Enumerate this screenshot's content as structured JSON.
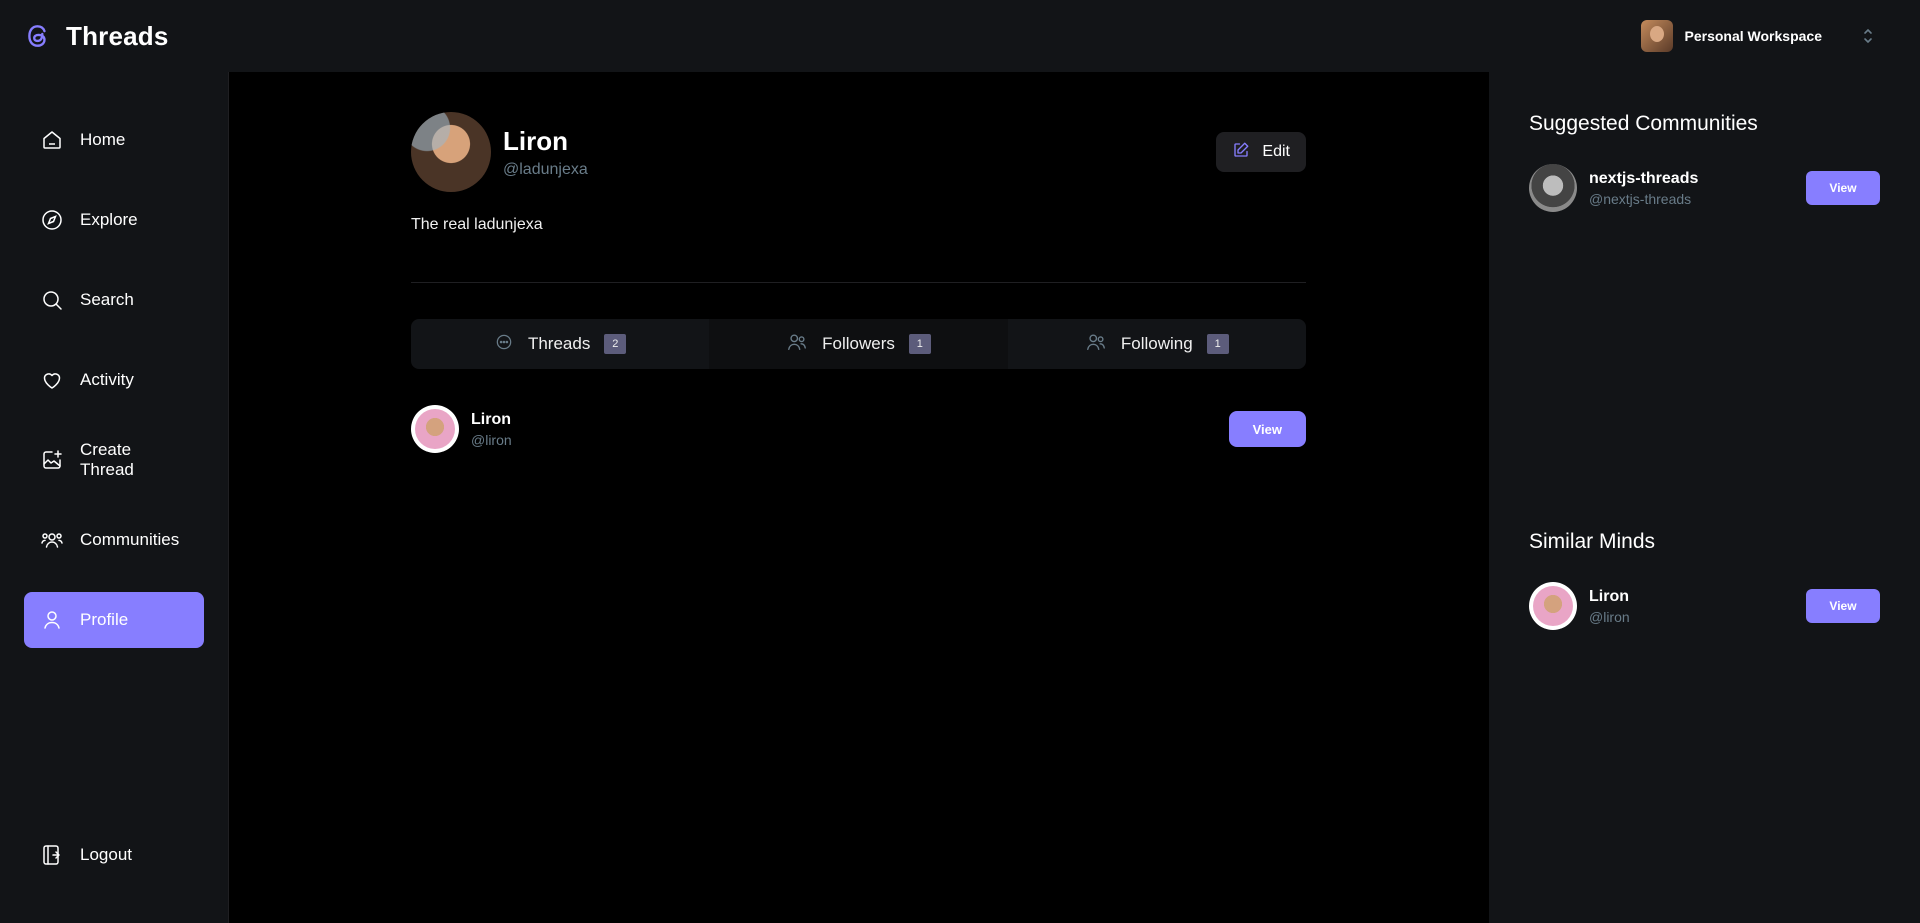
{
  "app": {
    "name": "Threads",
    "logo_icon": "threads-logo-icon"
  },
  "workspace": {
    "name": "Personal Workspace"
  },
  "sidebar": {
    "items": [
      {
        "label": "Home",
        "icon": "home-icon"
      },
      {
        "label": "Explore",
        "icon": "compass-icon"
      },
      {
        "label": "Search",
        "icon": "search-icon"
      },
      {
        "label": "Activity",
        "icon": "heart-icon"
      },
      {
        "label": "Create Thread",
        "icon": "create-image-icon"
      },
      {
        "label": "Communities",
        "icon": "users-icon"
      },
      {
        "label": "Profile",
        "icon": "user-icon",
        "active": true
      }
    ],
    "logout": {
      "label": "Logout",
      "icon": "logout-icon"
    }
  },
  "profile": {
    "name": "Liron",
    "handle": "@ladunjexa",
    "bio": "The real ladunjexa",
    "edit_label": "Edit"
  },
  "tabs": [
    {
      "label": "Threads",
      "count": "2"
    },
    {
      "label": "Followers",
      "count": "1",
      "active": true
    },
    {
      "label": "Following",
      "count": "1"
    }
  ],
  "members": [
    {
      "name": "Liron",
      "handle": "@liron",
      "button": "View"
    }
  ],
  "right": {
    "suggested_title": "Suggested Communities",
    "communities": [
      {
        "name": "nextjs-threads",
        "handle": "@nextjs-threads",
        "button": "View"
      }
    ],
    "similar_title": "Similar Minds",
    "users": [
      {
        "name": "Liron",
        "handle": "@liron",
        "button": "View"
      }
    ]
  },
  "colors": {
    "accent": "#877eff",
    "panel": "#121417",
    "muted": "#697c89"
  }
}
